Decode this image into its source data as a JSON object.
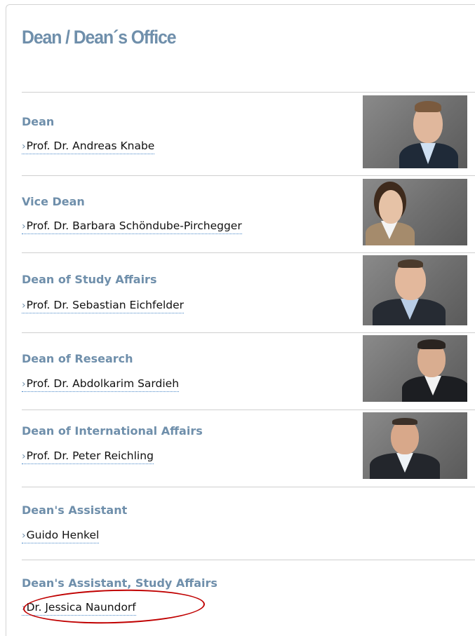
{
  "page": {
    "title": "Dean / Dean´s Office"
  },
  "entries": [
    {
      "role": "Dean",
      "chevron": "›",
      "name": "Prof. Dr. Andreas Knabe",
      "photo": "portrait of Prof. Dr. Andreas Knabe"
    },
    {
      "role": "Vice Dean",
      "chevron": "›",
      "name": "Prof. Dr. Barbara Schöndube-Pirchegger",
      "photo": "portrait of Prof. Dr. Barbara Schöndube-Pirchegger"
    },
    {
      "role": "Dean of Study Affairs",
      "chevron": "›",
      "name": "Prof. Dr. Sebastian Eichfelder",
      "photo": "portrait of Prof. Dr. Sebastian Eichfelder"
    },
    {
      "role": "Dean of Research",
      "chevron": "›",
      "name": "Prof. Dr. Abdolkarim Sardieh",
      "photo": "portrait of Prof. Dr. Abdolkarim Sardieh"
    },
    {
      "role": "Dean of International Affairs",
      "chevron": "›",
      "name": "Prof. Dr. Peter Reichling",
      "photo": "portrait of Prof. Dr. Peter Reichling"
    },
    {
      "role": "Dean's Assistant",
      "chevron": "›",
      "name": "Guido Henkel"
    },
    {
      "role": "Dean's Assistant, Study Affairs",
      "chevron": "›",
      "name": "Dr. Jessica Naundorf"
    }
  ],
  "colors": {
    "heading": "#6f8fab",
    "link_underline": "#4a88c8",
    "annotation": "#c00000"
  }
}
